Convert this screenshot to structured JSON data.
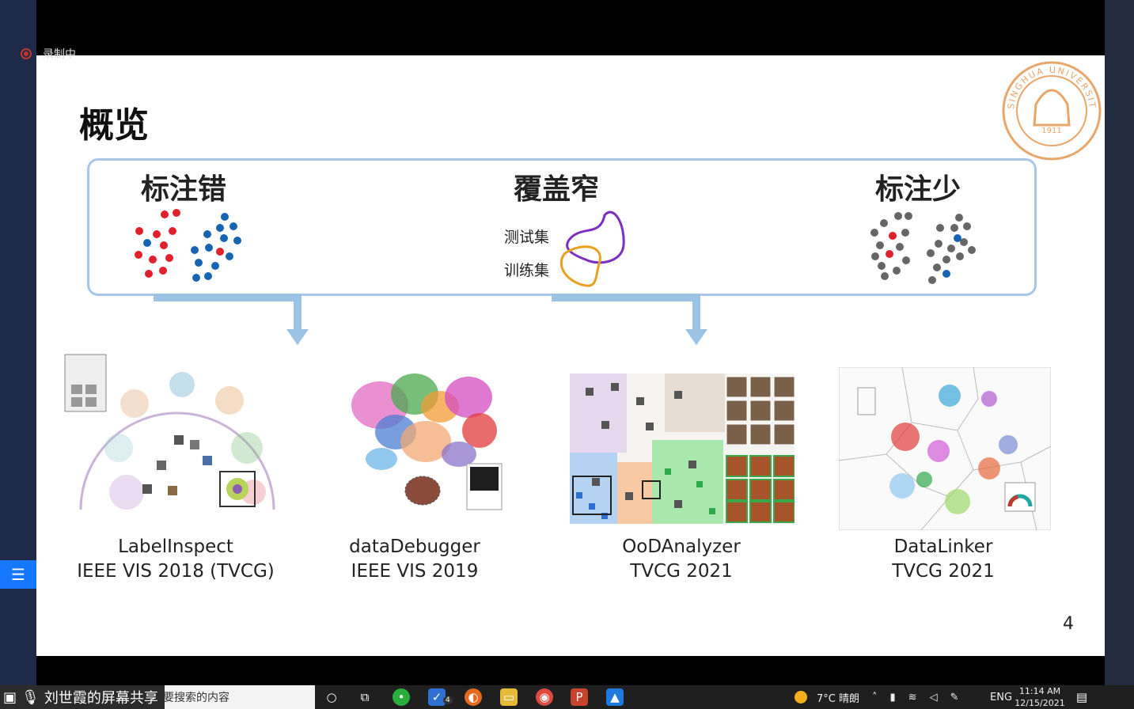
{
  "recording": {
    "label": "录制中"
  },
  "slide": {
    "title": "概览",
    "categories": [
      {
        "label": "标注错"
      },
      {
        "label": "覆盖窄",
        "test_label": "测试集",
        "train_label": "训练集"
      },
      {
        "label": "标注少"
      }
    ],
    "works": [
      {
        "name": "LabelInspect",
        "venue": "IEEE VIS 2018 (TVCG)"
      },
      {
        "name": "dataDebugger",
        "venue": "IEEE VIS 2019"
      },
      {
        "name": "OoDAnalyzer",
        "venue": "TVCG 2021"
      },
      {
        "name": "DataLinker",
        "venue": "TVCG 2021"
      }
    ],
    "page_number": "4",
    "seal_text": "TSINGHUA UNIVERSITY",
    "seal_year": "1911",
    "colors": {
      "red": "#e0202a",
      "blue": "#1565b0",
      "gray": "#666666",
      "panel_border": "#a8c6e8",
      "arrow": "#9cc3e6"
    }
  },
  "taskbar": {
    "share_label": "刘世霞的屏幕共享",
    "search_placeholder": "要搜索的内容",
    "weather": "7°C 晴朗",
    "language": "ENG",
    "time": "11:14 AM",
    "date": "12/15/2021",
    "notification_badge": "4"
  }
}
